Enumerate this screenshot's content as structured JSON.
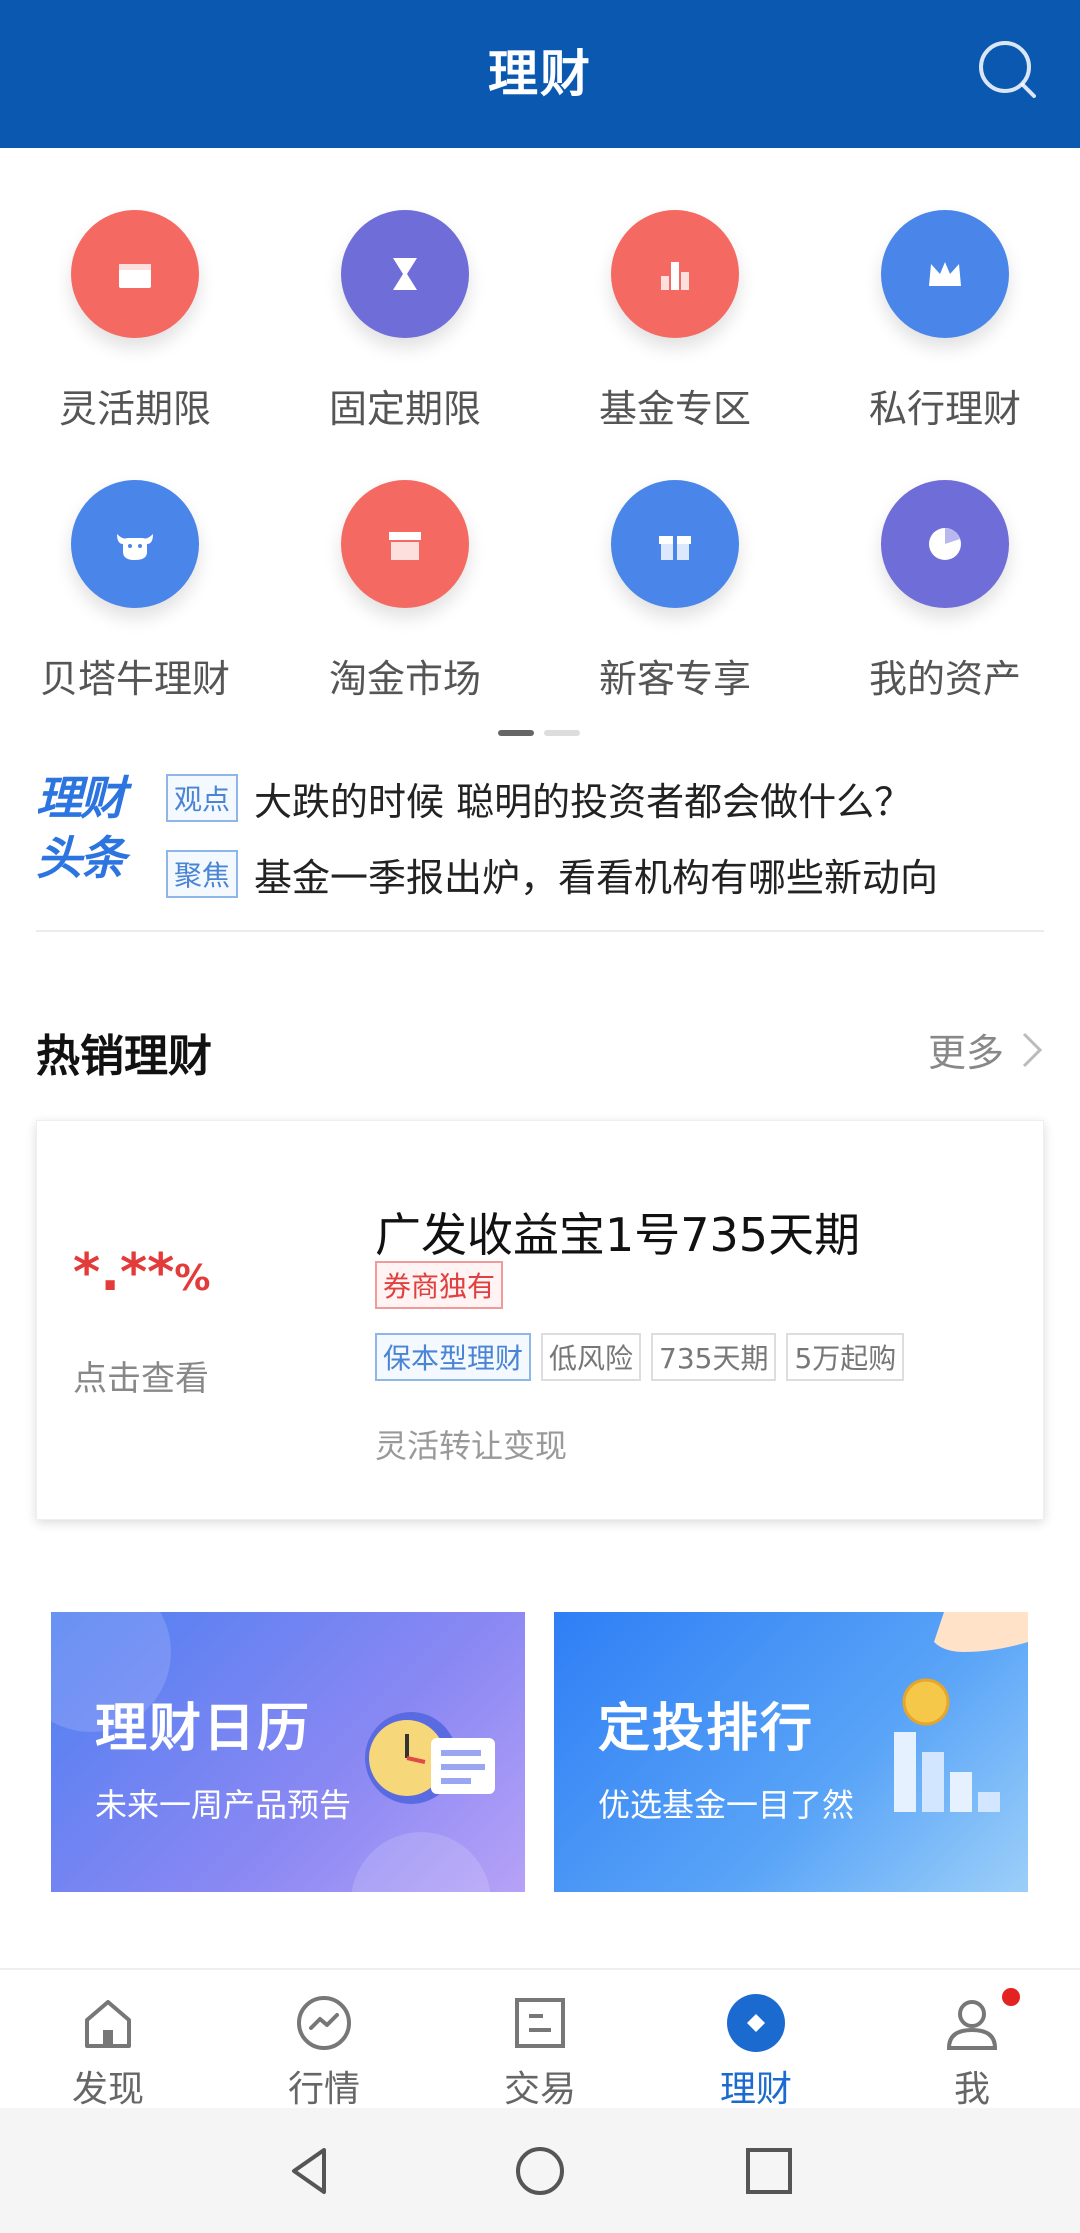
{
  "header": {
    "title": "理财"
  },
  "grid": {
    "items": [
      {
        "label": "灵活期限",
        "icon": "wallet-icon",
        "color": "#f46a63"
      },
      {
        "label": "固定期限",
        "icon": "hourglass-icon",
        "color": "#6f6dd8"
      },
      {
        "label": "基金专区",
        "icon": "bar-chart-icon",
        "color": "#f46a63"
      },
      {
        "label": "私行理财",
        "icon": "crown-icon",
        "color": "#4a86ea"
      },
      {
        "label": "贝塔牛理财",
        "icon": "bull-icon",
        "color": "#4a86ea"
      },
      {
        "label": "淘金市场",
        "icon": "store-icon",
        "color": "#f46a63"
      },
      {
        "label": "新客专享",
        "icon": "gift-icon",
        "color": "#4a86ea"
      },
      {
        "label": "我的资产",
        "icon": "pie-chart-icon",
        "color": "#6f6dd8"
      }
    ]
  },
  "news": {
    "logo_line1": "理财",
    "logo_line2": "头条",
    "items": [
      {
        "tag": "观点",
        "text": "大跌的时候 聪明的投资者都会做什么？"
      },
      {
        "tag": "聚焦",
        "text": "基金一季报出炉，看看机构有哪些新动向"
      }
    ]
  },
  "hot": {
    "title": "热销理财",
    "more": "更多"
  },
  "product": {
    "rate": "*.**",
    "rate_unit": "%",
    "rate_sub": "点击查看",
    "name": "广发收益宝1号735天期",
    "exclusive": "券商独有",
    "tags": [
      "保本型理财",
      "低风险",
      "735天期",
      "5万起购"
    ],
    "desc": "灵活转让变现"
  },
  "banners": [
    {
      "title": "理财日历",
      "sub": "未来一周产品预告"
    },
    {
      "title": "定投排行",
      "sub": "优选基金一目了然"
    }
  ],
  "nav": [
    {
      "label": "发现",
      "icon": "home-icon"
    },
    {
      "label": "行情",
      "icon": "trend-icon"
    },
    {
      "label": "交易",
      "icon": "trade-icon"
    },
    {
      "label": "理财",
      "icon": "finance-icon",
      "active": true
    },
    {
      "label": "我",
      "icon": "user-icon"
    }
  ],
  "colors": {
    "brand": "#0a58b0",
    "accent_red": "#e33a3a",
    "active_nav": "#1a6ad0"
  }
}
